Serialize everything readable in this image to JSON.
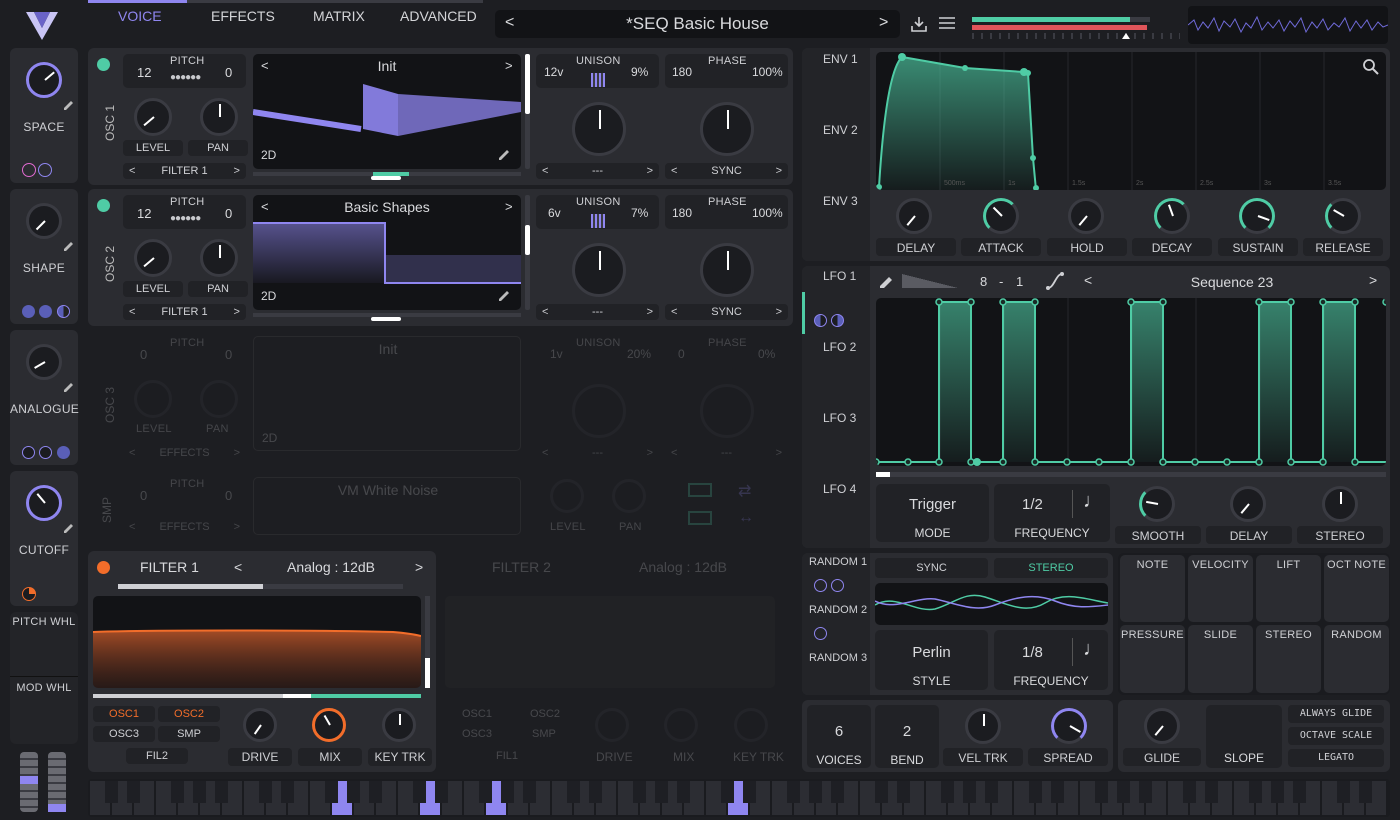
{
  "header": {
    "tabs": [
      "VOICE",
      "EFFECTS",
      "MATRIX",
      "ADVANCED"
    ],
    "preset": "*SEQ Basic House",
    "prev": "<",
    "next": ">"
  },
  "macros": [
    {
      "label": "SPACE"
    },
    {
      "label": "SHAPE"
    },
    {
      "label": "ANALOGUE"
    },
    {
      "label": "CUTOFF"
    }
  ],
  "wheels": {
    "pitch": "PITCH WHL",
    "mod": "MOD WHL"
  },
  "osc1": {
    "side": "OSC 1",
    "pitch_label": "PITCH",
    "pitch_val": "12",
    "pitch_fine": "0",
    "level": "LEVEL",
    "pan": "PAN",
    "dest": "FILTER 1",
    "wt": "Init",
    "mode": "2D",
    "unison_label": "UNISON",
    "voices": "12v",
    "detune": "9%",
    "phase_label": "PHASE",
    "phase": "180",
    "phase_rand": "100%",
    "spectral": "---",
    "sync": "SYNC"
  },
  "osc2": {
    "side": "OSC 2",
    "pitch_label": "PITCH",
    "pitch_val": "12",
    "pitch_fine": "0",
    "level": "LEVEL",
    "pan": "PAN",
    "dest": "FILTER 1",
    "wt": "Basic Shapes",
    "mode": "2D",
    "unison_label": "UNISON",
    "voices": "6v",
    "detune": "7%",
    "phase_label": "PHASE",
    "phase": "180",
    "phase_rand": "100%",
    "spectral": "---",
    "sync": "SYNC"
  },
  "osc3": {
    "side": "OSC 3",
    "pitch_label": "PITCH",
    "pitch_val": "0",
    "pitch_fine": "0",
    "level": "LEVEL",
    "pan": "PAN",
    "dest": "EFFECTS",
    "wt": "Init",
    "mode": "2D",
    "unison_label": "UNISON",
    "voices": "1v",
    "detune": "20%",
    "phase_label": "PHASE",
    "phase": "0",
    "phase_rand": "0%",
    "spectral": "---",
    "sync": "---"
  },
  "smp": {
    "side": "SMP",
    "pitch_label": "PITCH",
    "pitch_val": "0",
    "pitch_fine": "0",
    "dest": "EFFECTS",
    "sample": "VM White Noise",
    "level": "LEVEL",
    "pan": "PAN"
  },
  "filter1": {
    "title": "FILTER 1",
    "model": "Analog",
    "type": "12dB",
    "sep": ":",
    "sources": [
      "OSC1",
      "OSC2",
      "OSC3",
      "SMP"
    ],
    "fil": "FIL2",
    "drive": "DRIVE",
    "mix": "MIX",
    "keytrk": "KEY TRK"
  },
  "filter2": {
    "title": "FILTER 2",
    "model": "Analog",
    "type": "12dB",
    "sep": ":",
    "sources": [
      "OSC1",
      "OSC2",
      "OSC3",
      "SMP"
    ],
    "fil": "FIL1",
    "drive": "DRIVE",
    "mix": "MIX",
    "keytrk": "KEY TRK"
  },
  "env": {
    "tabs": [
      "ENV 1",
      "ENV 2",
      "ENV 3"
    ],
    "times": [
      "500ms",
      "1s",
      "1.5s",
      "2s",
      "2.5s",
      "3s",
      "3.5s"
    ],
    "knobs": [
      "DELAY",
      "ATTACK",
      "HOLD",
      "DECAY",
      "SUSTAIN",
      "RELEASE"
    ]
  },
  "lfo": {
    "tabs": [
      "LFO 1",
      "LFO 2",
      "LFO 3",
      "LFO 4"
    ],
    "num": "8",
    "dash": "-",
    "den": "1",
    "shape": "Sequence 23",
    "mode_val": "Trigger",
    "mode_lbl": "MODE",
    "freq_val": "1/2",
    "freq_lbl": "FREQUENCY",
    "smooth": "SMOOTH",
    "delay": "DELAY",
    "stereo": "STEREO"
  },
  "random": {
    "tabs": [
      "RANDOM 1",
      "RANDOM 2",
      "RANDOM 3"
    ],
    "sync": "SYNC",
    "stereo": "STEREO",
    "style_val": "Perlin",
    "style_lbl": "STYLE",
    "freq_val": "1/8",
    "freq_lbl": "FREQUENCY"
  },
  "mods": [
    "NOTE",
    "VELOCITY",
    "LIFT",
    "OCT NOTE",
    "PRESSURE",
    "SLIDE",
    "STEREO",
    "RANDOM"
  ],
  "voice": {
    "voices_val": "6",
    "voices_lbl": "VOICES",
    "bend_val": "2",
    "bend_lbl": "BEND",
    "veltrk": "VEL TRK",
    "spread": "SPREAD"
  },
  "glide": {
    "glide": "GLIDE",
    "slope": "SLOPE",
    "opts": [
      "ALWAYS GLIDE",
      "OCTAVE SCALE",
      "LEGATO"
    ]
  },
  "colors": {
    "accent": "#8f86f0",
    "teal": "#4fcca5",
    "orange": "#f26d2a",
    "bg": "#1d1e22",
    "panel": "#2b2c31"
  }
}
